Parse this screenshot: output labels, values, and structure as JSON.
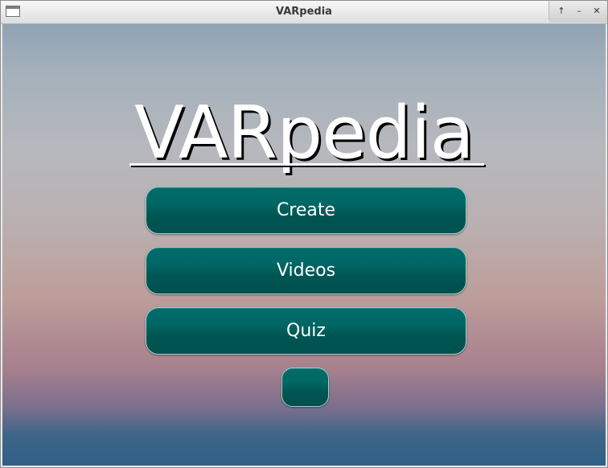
{
  "window": {
    "title": "VARpedia",
    "controls": {
      "maximize_icon": "up-arrow-icon",
      "minimize_icon": "minimize-icon",
      "close_icon": "close-icon",
      "maximize_glyph": "↑",
      "minimize_glyph": "–",
      "close_glyph": "✕"
    }
  },
  "main": {
    "logo": "VARpedia",
    "buttons": {
      "create": "Create",
      "videos": "Videos",
      "quiz": "Quiz",
      "extra": ""
    }
  },
  "colors": {
    "button_fill": "#006765",
    "button_border": "#9fd0cc",
    "logo_text": "#ffffff"
  }
}
